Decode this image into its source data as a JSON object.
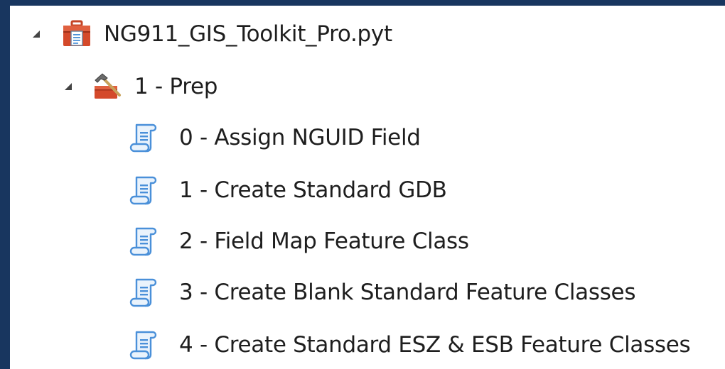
{
  "tree": {
    "root": {
      "label": "NG911_GIS_Toolkit_Pro.pyt",
      "icon": "python-toolbox-icon",
      "expanded": true
    },
    "toolset": {
      "label": "1 - Prep",
      "icon": "toolset-hammer-icon",
      "expanded": true
    },
    "tools": [
      {
        "label": "0 - Assign NGUID Field",
        "icon": "script-tool-icon"
      },
      {
        "label": "1 - Create Standard GDB",
        "icon": "script-tool-icon"
      },
      {
        "label": "2 - Field Map Feature Class",
        "icon": "script-tool-icon"
      },
      {
        "label": "3 - Create Blank Standard Feature Classes",
        "icon": "script-tool-icon"
      },
      {
        "label": "4 - Create Standard ESZ & ESB Feature Classes",
        "icon": "script-tool-icon"
      }
    ]
  },
  "colors": {
    "background_border": "#18365f",
    "panel": "#ffffff",
    "text": "#1e1e1e",
    "caret": "#444444",
    "toolbox_red": "#d4492a",
    "script_blue": "#4a90d9"
  }
}
